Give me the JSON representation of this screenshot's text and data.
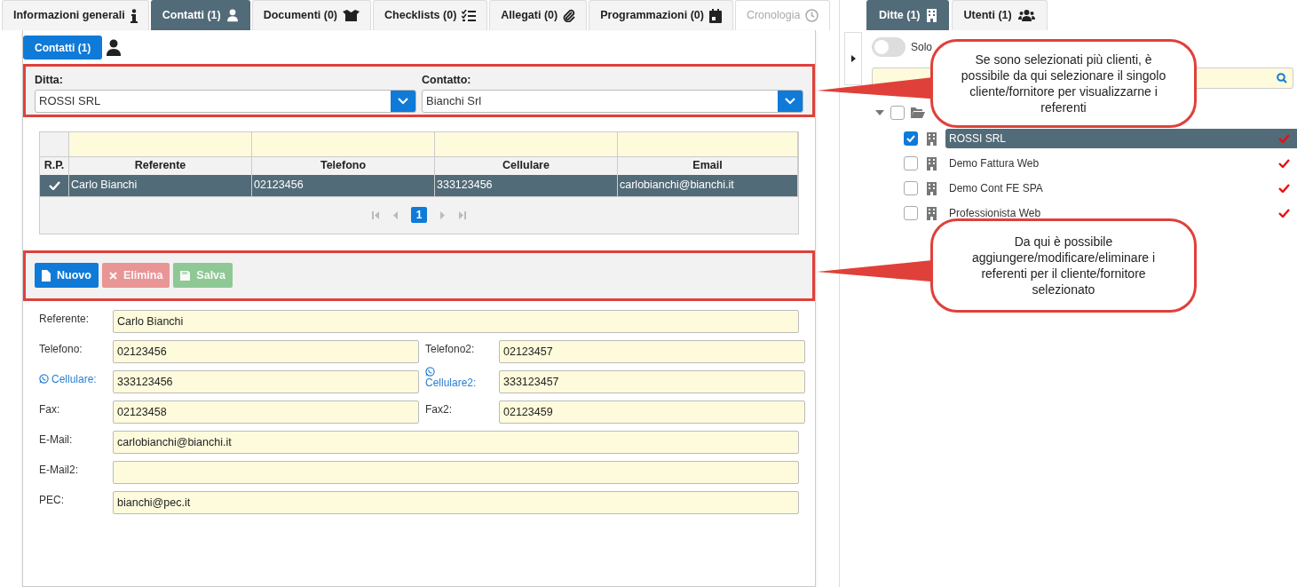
{
  "tabs": [
    {
      "label": "Informazioni generali",
      "selected": false,
      "disabled": false
    },
    {
      "label": "Contatti (1)",
      "selected": true,
      "disabled": false
    },
    {
      "label": "Documenti (0)",
      "selected": false,
      "disabled": false
    },
    {
      "label": "Checklists (0)",
      "selected": false,
      "disabled": false
    },
    {
      "label": "Allegati (0)",
      "selected": false,
      "disabled": false
    },
    {
      "label": "Programmazioni (0)",
      "selected": false,
      "disabled": false
    },
    {
      "label": "Cronologia",
      "selected": false,
      "disabled": true
    }
  ],
  "section_button": "Contatti (1)",
  "selectors": [
    {
      "label": "Ditta:",
      "value": "ROSSI SRL"
    },
    {
      "label": "Contatto:",
      "value": "Bianchi Srl"
    }
  ],
  "table": {
    "rp_column": "R.P.",
    "columns": [
      "Referente",
      "Telefono",
      "Cellulare",
      "Email"
    ],
    "rows": [
      {
        "selected": true,
        "rp": true,
        "cells": [
          "Carlo Bianchi",
          "02123456",
          "333123456",
          "carlobianchi@bianchi.it"
        ]
      }
    ],
    "page": "1"
  },
  "actions": [
    {
      "label": "Nuovo",
      "kind": "new",
      "disabled": false
    },
    {
      "label": "Elimina",
      "kind": "delete",
      "disabled": true
    },
    {
      "label": "Salva",
      "kind": "save",
      "disabled": true
    }
  ],
  "form": [
    {
      "kind": "full",
      "fields": [
        {
          "label": "Referente:",
          "value": "Carlo Bianchi",
          "whatsapp": false
        }
      ]
    },
    {
      "kind": "pair",
      "fields": [
        {
          "label": "Telefono:",
          "value": "02123456",
          "whatsapp": false
        },
        {
          "label": "Telefono2:",
          "value": "02123457",
          "whatsapp": false
        }
      ]
    },
    {
      "kind": "pair",
      "fields": [
        {
          "label": "Cellulare:",
          "value": "333123456",
          "whatsapp": true
        },
        {
          "label": "Cellulare2:",
          "value": "333123457",
          "whatsapp": true
        }
      ]
    },
    {
      "kind": "pair",
      "fields": [
        {
          "label": "Fax:",
          "value": "02123458",
          "whatsapp": false
        },
        {
          "label": "Fax2:",
          "value": "02123459",
          "whatsapp": false
        }
      ]
    },
    {
      "kind": "full",
      "fields": [
        {
          "label": "E-Mail:",
          "value": "carlobianchi@bianchi.it",
          "whatsapp": false
        }
      ]
    },
    {
      "kind": "full",
      "fields": [
        {
          "label": "E-Mail2:",
          "whatsapp": false
        }
      ]
    },
    {
      "kind": "full",
      "fields": [
        {
          "label": "PEC:",
          "value": "bianchi@pec.it",
          "whatsapp": false
        }
      ]
    }
  ],
  "side_tabs": [
    {
      "label": "Ditte (1)",
      "selected": true
    },
    {
      "label": "Utenti (1)",
      "selected": false
    }
  ],
  "toggle": {
    "label": "Solo",
    "on": false
  },
  "tree": {
    "expanded": true,
    "checked": false,
    "children": [
      {
        "name": "ROSSI SRL",
        "checked": true,
        "selected": true
      },
      {
        "name": "Demo Fattura Web",
        "checked": false,
        "selected": false
      },
      {
        "name": "Demo Cont FE SPA",
        "checked": false,
        "selected": false
      },
      {
        "name": "Professionista Web",
        "checked": false,
        "selected": false
      }
    ]
  },
  "callouts": [
    "Se sono selezionati più clienti, è possibile da qui selezionare il singolo cliente/fornitore per visualizzarne i referenti",
    "Da qui è possibile aggiungere/modificare/eliminare i referenti per il cliente/fornitore selezionato"
  ]
}
